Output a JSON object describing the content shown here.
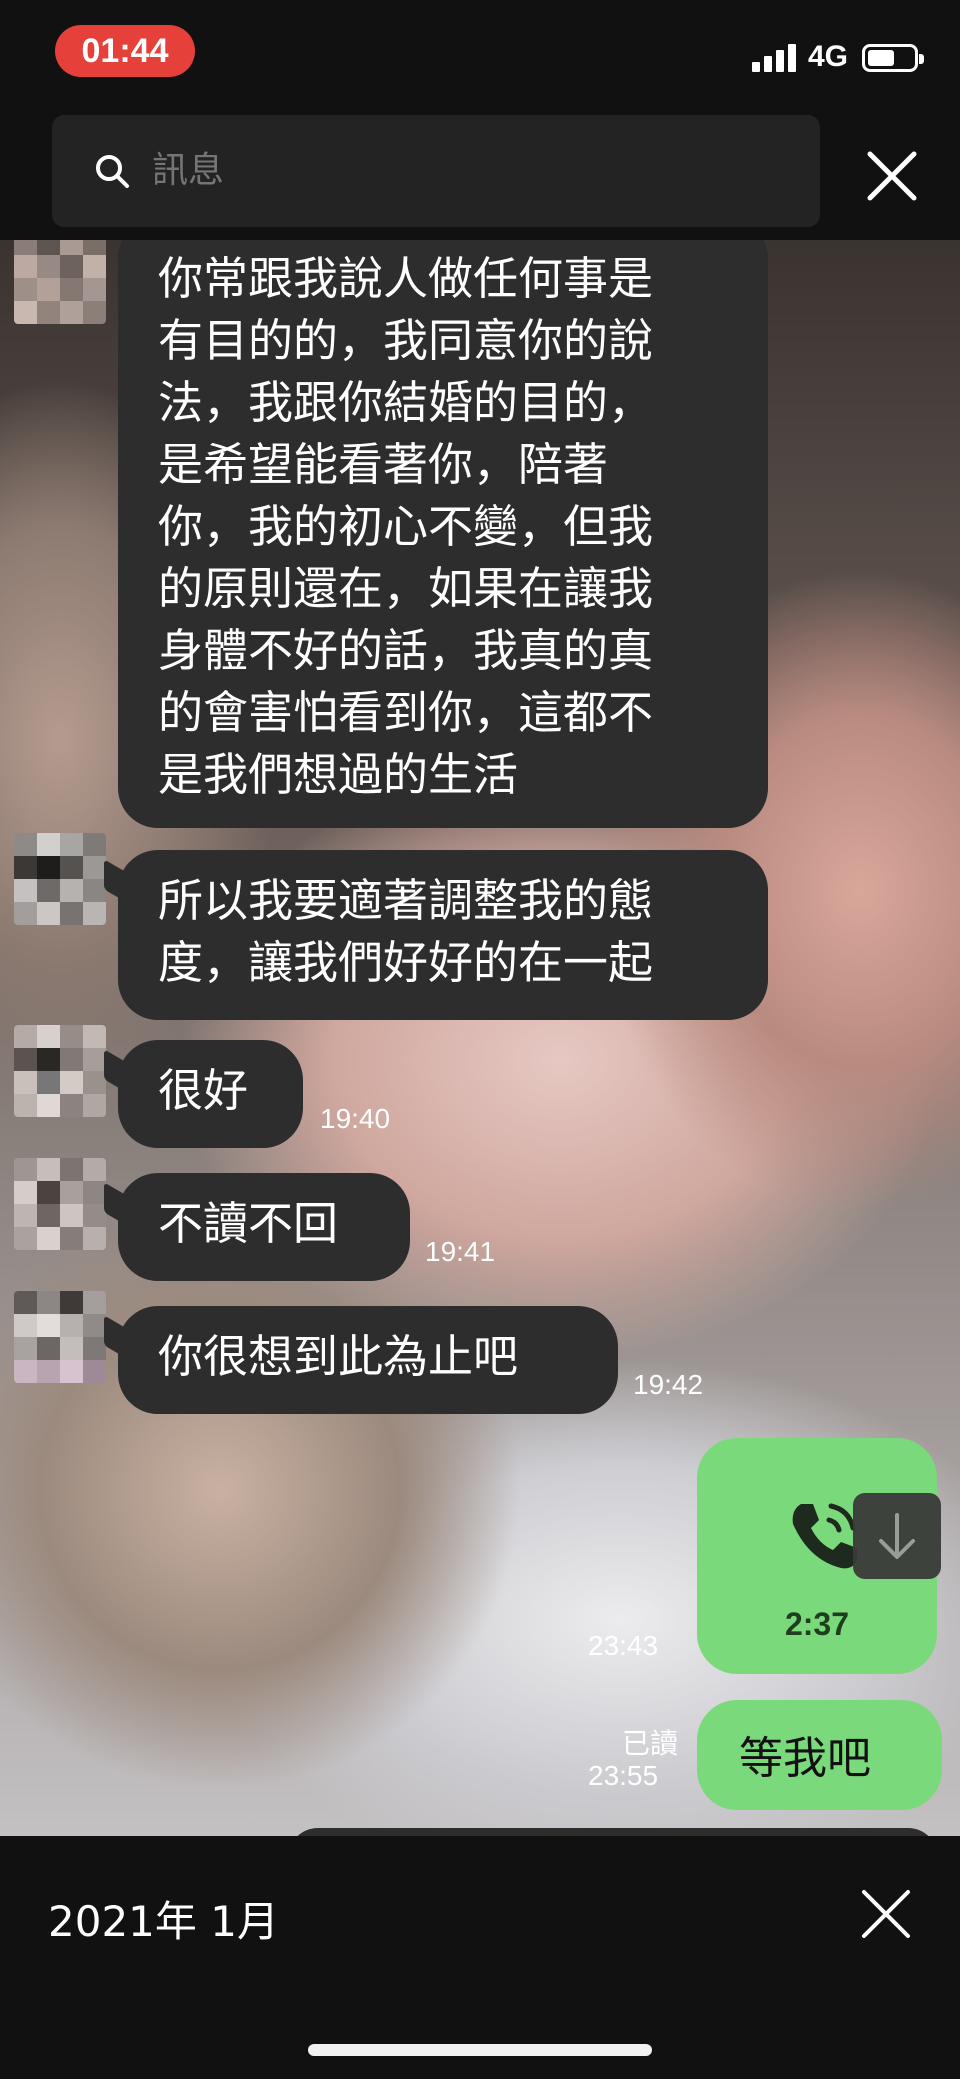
{
  "status_bar": {
    "time": "01:44",
    "network": "4G",
    "battery_level": 0.6
  },
  "search": {
    "placeholder": "訊息"
  },
  "messages": [
    {
      "side": "left",
      "text": "你常跟我說人做任何事是有目的的，我同意你的說法，我跟你結婚的目的，是希望能看著你，陪著你，我的初心不變，但我的原則還在，如果在讓我身體不好的話，我真的真的會害怕看到你，這都不是我們想過的生活",
      "lines": [
        "你常跟我說人做任何事是",
        "有目的的，我同意你的說",
        "法，我跟你結婚的目的，",
        "是希望能看著你，陪著",
        "你，我的初心不變，但我",
        "的原則還在，如果在讓我",
        "身體不好的話，我真的真",
        "的會害怕看到你，這都不",
        "是我們想過的生活"
      ]
    },
    {
      "side": "left",
      "lines": [
        "所以我要適著調整我的態",
        "度，讓我們好好的在一起"
      ]
    },
    {
      "side": "left",
      "text": "很好",
      "time": "19:40"
    },
    {
      "side": "left",
      "text": "不讀不回",
      "time": "19:41"
    },
    {
      "side": "left",
      "text": "你很想到此為止吧",
      "time": "19:42"
    },
    {
      "side": "right",
      "type": "call",
      "duration": "2:37",
      "time": "23:43",
      "icon": "phone-call-icon"
    },
    {
      "side": "right",
      "text": "等我吧",
      "read": "已讀",
      "time": "23:55"
    }
  ],
  "footer": {
    "date": "2021年 1月"
  },
  "colors": {
    "left_bubble": "#2d2d2d",
    "right_bubble": "#7ad97a",
    "time_pill": "#e5413a",
    "background": "#111111"
  }
}
